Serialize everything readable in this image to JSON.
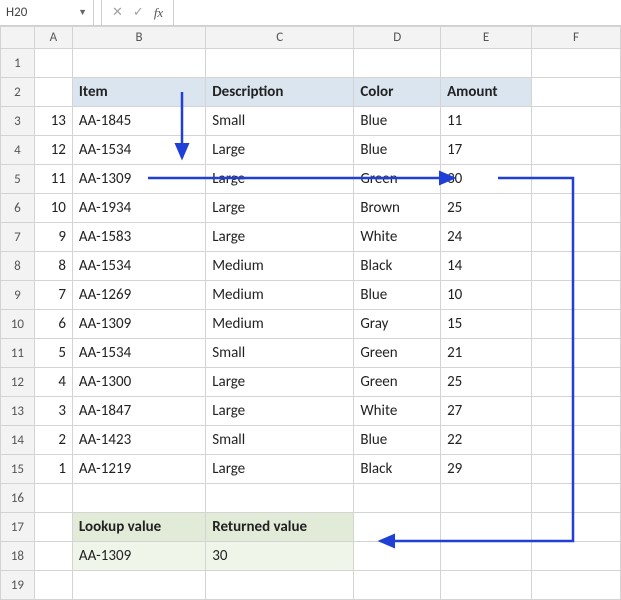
{
  "formula_bar": {
    "cell_ref": "H20",
    "fx_label": "fx",
    "formula": ""
  },
  "col_headers": [
    "A",
    "B",
    "C",
    "D",
    "E",
    "F"
  ],
  "row_headers": [
    "1",
    "2",
    "3",
    "4",
    "5",
    "6",
    "7",
    "8",
    "9",
    "10",
    "11",
    "12",
    "13",
    "14",
    "15",
    "16",
    "17",
    "18",
    "19"
  ],
  "table": {
    "headers": {
      "item": "Item",
      "description": "Description",
      "color": "Color",
      "amount": "Amount"
    },
    "rows": [
      {
        "n": "13",
        "item": "AA-1845",
        "desc": "Small",
        "color": "Blue",
        "amt": "11"
      },
      {
        "n": "12",
        "item": "AA-1534",
        "desc": "Large",
        "color": "Blue",
        "amt": "17"
      },
      {
        "n": "11",
        "item": "AA-1309",
        "desc": "Large",
        "color": "Green",
        "amt": "30"
      },
      {
        "n": "10",
        "item": "AA-1934",
        "desc": "Large",
        "color": "Brown",
        "amt": "25"
      },
      {
        "n": "9",
        "item": "AA-1583",
        "desc": "Large",
        "color": "White",
        "amt": "24"
      },
      {
        "n": "8",
        "item": "AA-1534",
        "desc": "Medium",
        "color": "Black",
        "amt": "14"
      },
      {
        "n": "7",
        "item": "AA-1269",
        "desc": "Medium",
        "color": "Blue",
        "amt": "10"
      },
      {
        "n": "6",
        "item": "AA-1309",
        "desc": "Medium",
        "color": "Gray",
        "amt": "15"
      },
      {
        "n": "5",
        "item": "AA-1534",
        "desc": "Small",
        "color": "Green",
        "amt": "21"
      },
      {
        "n": "4",
        "item": "AA-1300",
        "desc": "Large",
        "color": "Green",
        "amt": "25"
      },
      {
        "n": "3",
        "item": "AA-1847",
        "desc": "Large",
        "color": "White",
        "amt": "27"
      },
      {
        "n": "2",
        "item": "AA-1423",
        "desc": "Small",
        "color": "Blue",
        "amt": "22"
      },
      {
        "n": "1",
        "item": "AA-1219",
        "desc": "Large",
        "color": "Black",
        "amt": "29"
      }
    ]
  },
  "result": {
    "lookup_label": "Lookup value",
    "return_label": "Returned value",
    "lookup_value": "AA-1309",
    "return_value": "30"
  }
}
